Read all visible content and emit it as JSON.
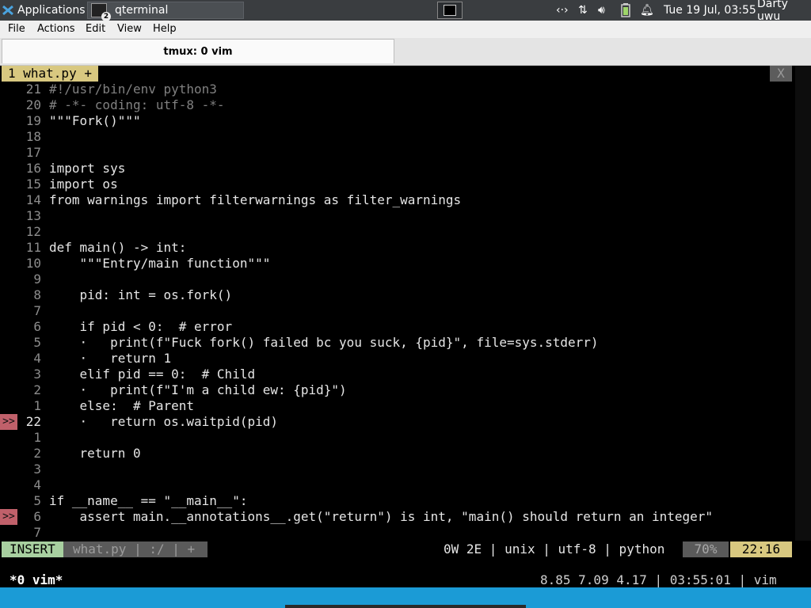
{
  "panel": {
    "applications": "Applications",
    "task_title": "qterminal",
    "task_badge": "2",
    "clock": "Tue 19 Jul, 03:55",
    "user": "Darty uwu"
  },
  "menu": [
    "File",
    "Actions",
    "Edit",
    "View",
    "Help"
  ],
  "tab": {
    "title": "tmux: 0 vim"
  },
  "vim": {
    "buffer_label": "1 what.py +",
    "close_label": "X",
    "lines": [
      {
        "n": "21",
        "t": "#!/usr/bin/env python3",
        "cls": "cm"
      },
      {
        "n": "20",
        "t": "# -*- coding: utf-8 -*-",
        "cls": "cm"
      },
      {
        "n": "19",
        "t": "\"\"\"Fork()\"\"\""
      },
      {
        "n": "18",
        "t": ""
      },
      {
        "n": "17",
        "t": ""
      },
      {
        "n": "16",
        "t": "import sys"
      },
      {
        "n": "15",
        "t": "import os"
      },
      {
        "n": "14",
        "t": "from warnings import filterwarnings as filter_warnings"
      },
      {
        "n": "13",
        "t": ""
      },
      {
        "n": "12",
        "t": ""
      },
      {
        "n": "11",
        "t": "def main() -> int:"
      },
      {
        "n": "10",
        "t": "    \"\"\"Entry/main function\"\"\""
      },
      {
        "n": "9",
        "t": ""
      },
      {
        "n": "8",
        "t": "    pid: int = os.fork()"
      },
      {
        "n": "7",
        "t": ""
      },
      {
        "n": "6",
        "t": "    if pid < 0:  # error"
      },
      {
        "n": "5",
        "t": "    ·   print(f\"Fuck fork() failed bc you suck, {pid}\", file=sys.stderr)"
      },
      {
        "n": "4",
        "t": "    ·   return 1"
      },
      {
        "n": "3",
        "t": "    elif pid == 0:  # Child"
      },
      {
        "n": "2",
        "t": "    ·   print(f\"I'm a child ew: {pid}\")"
      },
      {
        "n": "1",
        "t": "    else:  # Parent"
      },
      {
        "n": "22",
        "t": "    ·   return os.waitpid(pid)",
        "cur": true,
        "sign": ">>"
      },
      {
        "n": "1",
        "t": ""
      },
      {
        "n": "2",
        "t": "    return 0"
      },
      {
        "n": "3",
        "t": ""
      },
      {
        "n": "4",
        "t": ""
      },
      {
        "n": "5",
        "t": "if __name__ == \"__main__\":"
      },
      {
        "n": "6",
        "t": "    assert main.__annotations__.get(\"return\") is int, \"main() should return an integer\"",
        "sign": ">>"
      },
      {
        "n": "7",
        "t": ""
      }
    ],
    "status": {
      "mode": "INSERT",
      "file": "what.py | :/ | +",
      "info": "0W 2E | unix | utf-8 | python",
      "percent": "70%",
      "position": "22:16"
    }
  },
  "tmux": {
    "window": "*0 vim*",
    "right": "8.85 7.09 4.17 | 03:55:01 | vim"
  }
}
